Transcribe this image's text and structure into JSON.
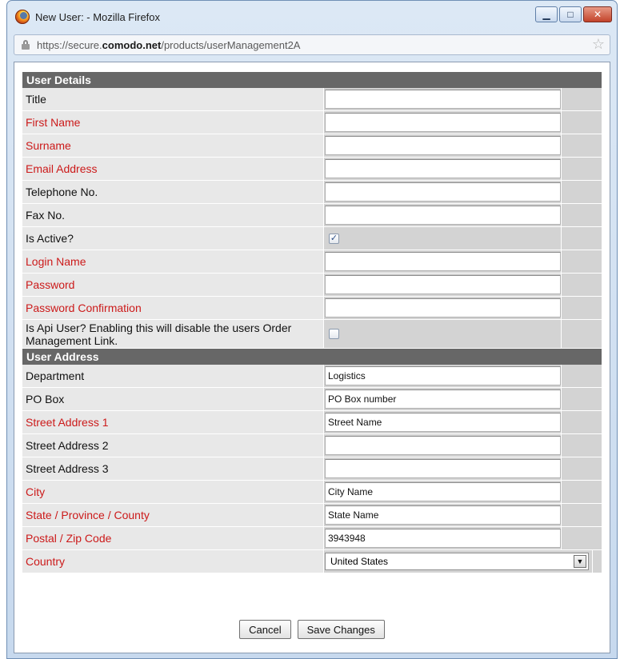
{
  "window": {
    "title": "New User: - Mozilla Firefox",
    "url_prefix": "https://secure.",
    "url_domain": "comodo.net",
    "url_path": "/products/userManagement2A",
    "controls": {
      "minimize": "▁",
      "maximize": "□",
      "close": "✕"
    }
  },
  "sections": {
    "user_details": "User Details",
    "user_address": "User Address"
  },
  "user_details": [
    {
      "label": "Title",
      "required": false,
      "type": "text",
      "value": ""
    },
    {
      "label": "First Name",
      "required": true,
      "type": "text",
      "value": ""
    },
    {
      "label": "Surname",
      "required": true,
      "type": "text",
      "value": ""
    },
    {
      "label": "Email Address",
      "required": true,
      "type": "text",
      "value": ""
    },
    {
      "label": "Telephone No.",
      "required": false,
      "type": "text",
      "value": ""
    },
    {
      "label": "Fax No.",
      "required": false,
      "type": "text",
      "value": ""
    },
    {
      "label": "Is Active?",
      "required": false,
      "type": "checkbox",
      "checked": true
    },
    {
      "label": "Login Name",
      "required": true,
      "type": "text",
      "value": ""
    },
    {
      "label": "Password",
      "required": true,
      "type": "text",
      "value": ""
    },
    {
      "label": "Password Confirmation",
      "required": true,
      "type": "text",
      "value": ""
    },
    {
      "label": "Is Api User? Enabling this will disable the users Order Management Link.",
      "required": false,
      "type": "checkbox",
      "checked": false
    }
  ],
  "user_address": [
    {
      "label": "Department",
      "required": false,
      "type": "text",
      "value": "Logistics"
    },
    {
      "label": "PO Box",
      "required": false,
      "type": "text",
      "value": "PO Box number"
    },
    {
      "label": "Street Address 1",
      "required": true,
      "type": "text",
      "value": "Street Name"
    },
    {
      "label": "Street Address 2",
      "required": false,
      "type": "text",
      "value": ""
    },
    {
      "label": "Street Address 3",
      "required": false,
      "type": "text",
      "value": ""
    },
    {
      "label": "City",
      "required": true,
      "type": "text",
      "value": "City Name"
    },
    {
      "label": "State / Province / County",
      "required": true,
      "type": "text",
      "value": "State Name"
    },
    {
      "label": "Postal / Zip Code",
      "required": true,
      "type": "text",
      "value": "3943948"
    },
    {
      "label": "Country",
      "required": true,
      "type": "select",
      "value": "United States"
    }
  ],
  "buttons": {
    "cancel": "Cancel",
    "save": "Save Changes"
  },
  "colors": {
    "required_label": "#cc1a1a",
    "section_header": "#676767"
  },
  "icons": [
    "firefox-logo-icon",
    "lock-icon",
    "bookmark-star-icon",
    "checkmark-icon",
    "dropdown-arrow-icon"
  ]
}
